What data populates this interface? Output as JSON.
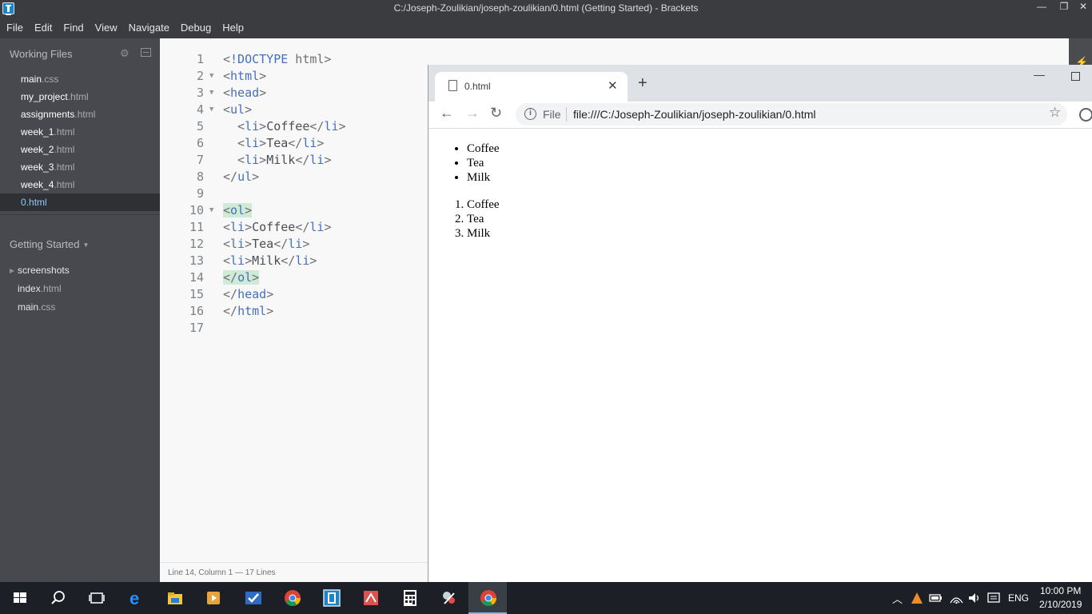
{
  "window": {
    "title": "C:/Joseph-Zoulikian/joseph-zoulikian/0.html (Getting Started) - Brackets",
    "minimize": "—",
    "restore": "❐",
    "close": "✕"
  },
  "menu": [
    "File",
    "Edit",
    "Find",
    "View",
    "Navigate",
    "Debug",
    "Help"
  ],
  "sidebar": {
    "working_files_label": "Working Files",
    "working_files": [
      {
        "name": "main",
        "ext": ".css"
      },
      {
        "name": "my_project",
        "ext": ".html"
      },
      {
        "name": "assignments",
        "ext": ".html"
      },
      {
        "name": "week_1",
        "ext": ".html"
      },
      {
        "name": "week_2",
        "ext": ".html"
      },
      {
        "name": "week_3",
        "ext": ".html"
      },
      {
        "name": "week_4",
        "ext": ".html"
      },
      {
        "name": "0",
        "ext": ".html",
        "selected": true
      }
    ],
    "project_label": "Getting Started",
    "project_files": [
      {
        "name": "screenshots",
        "ext": "",
        "folder": true
      },
      {
        "name": "index",
        "ext": ".html"
      },
      {
        "name": "main",
        "ext": ".css"
      }
    ]
  },
  "editor": {
    "lines": [
      {
        "n": "1",
        "fold": "",
        "code": "<!DOCTYPE html>"
      },
      {
        "n": "2",
        "fold": "▼",
        "code": "<html>"
      },
      {
        "n": "3",
        "fold": "▼",
        "code": "<head>"
      },
      {
        "n": "4",
        "fold": "▼",
        "code": "<ul>"
      },
      {
        "n": "5",
        "fold": "",
        "code": "  <li>Coffee</li>"
      },
      {
        "n": "6",
        "fold": "",
        "code": "  <li>Tea</li>"
      },
      {
        "n": "7",
        "fold": "",
        "code": "  <li>Milk</li>"
      },
      {
        "n": "8",
        "fold": "",
        "code": "</ul>"
      },
      {
        "n": "9",
        "fold": "",
        "code": ""
      },
      {
        "n": "10",
        "fold": "▼",
        "code": "<ol>"
      },
      {
        "n": "11",
        "fold": "",
        "code": "<li>Coffee</li>"
      },
      {
        "n": "12",
        "fold": "",
        "code": "<li>Tea</li>"
      },
      {
        "n": "13",
        "fold": "",
        "code": "<li>Milk</li>"
      },
      {
        "n": "14",
        "fold": "",
        "code": "</ol>"
      },
      {
        "n": "15",
        "fold": "",
        "code": "</head>"
      },
      {
        "n": "16",
        "fold": "",
        "code": "</html>"
      },
      {
        "n": "17",
        "fold": "",
        "code": ""
      }
    ],
    "highlighted_lines": [
      "10",
      "14"
    ]
  },
  "status": {
    "position": "Line 14, Column 1",
    "lines": " — 17 Lines"
  },
  "chrome": {
    "tab_title": "0.html",
    "tab_close": "✕",
    "new_tab": "+",
    "back": "←",
    "forward": "→",
    "reload": "↻",
    "info": "i",
    "file_label": "File",
    "url": "file:///C:/Joseph-Zoulikian/joseph-zoulikian/0.html",
    "star": "☆",
    "minimize": "—",
    "page": {
      "ul": [
        "Coffee",
        "Tea",
        "Milk"
      ],
      "ol": [
        "Coffee",
        "Tea",
        "Milk"
      ]
    }
  },
  "taskbar": {
    "apps": [
      "start",
      "search",
      "task-view",
      "edge",
      "file-explorer",
      "vlc",
      "todo",
      "chrome",
      "brackets",
      "pdf-reader",
      "calculator",
      "snipping-tool",
      "chrome-active"
    ],
    "tray_language": "ENG",
    "time": "10:00 PM",
    "date": "2/10/2019"
  },
  "colors": {
    "accent_blue": "#446fbd",
    "highlight_green": "#cfead6",
    "sidebar_bg": "#47494e",
    "selected_file": "#8ecbff"
  }
}
